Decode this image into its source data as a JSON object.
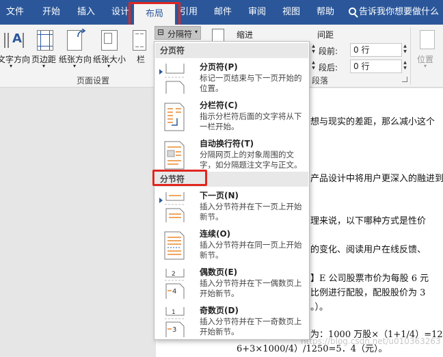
{
  "tabs": [
    "文件",
    "开始",
    "插入",
    "设计",
    "布局",
    "引用",
    "邮件",
    "审阅",
    "视图",
    "帮助"
  ],
  "active_tab": "布局",
  "tell_me": "告诉我你想要做什么",
  "ribbon": {
    "buttons": {
      "text_direction": "文字方向",
      "margins": "页边距",
      "orientation": "纸张方向",
      "size": "纸张大小",
      "columns": "栏"
    },
    "breaks_button": "分隔符",
    "group_page_setup": "页面设置",
    "indent_label": "缩进",
    "spacing_label": "间距",
    "spacing_before_label": "段前:",
    "spacing_before_value": "0 行",
    "spacing_after_label": "段后:",
    "spacing_after_value": "0 行",
    "group_paragraph_partial": "段落",
    "position_label": "位置"
  },
  "breaks_menu": {
    "page_breaks_header": "分页符",
    "page_items": [
      {
        "title": "分页符(P)",
        "desc": "标记一页结束与下一页开始的位置。"
      },
      {
        "title": "分栏符(C)",
        "desc": "指示分栏符后面的文字将从下一栏开始。"
      },
      {
        "title": "自动换行符(T)",
        "desc": "分隔网页上的对象周围的文字，如分隔题注文字与正文。"
      }
    ],
    "section_breaks_header": "分节符",
    "section_items": [
      {
        "title": "下一页(N)",
        "desc": "插入分节符并在下一页上开始新节。"
      },
      {
        "title": "连续(O)",
        "desc": "插入分节符并在同一页上开始新节。"
      },
      {
        "title": "偶数页(E)",
        "desc": "插入分节符并在下一偶数页上开始新节。"
      },
      {
        "title": "奇数页(D)",
        "desc": "插入分节符并在下一奇数页上开始新节。"
      }
    ]
  },
  "document_lines": [
    "想与现实的差距，那么减小这个",
    "产品设计中将用户更深入的融进到",
    "理来说，以下哪种方式是性价",
    "的变化、阅读用户在线反馈、",
    "】E 公司股票市价为每股 6 元",
    "比例进行配股，配股股价为 3",
    "。）。",
    "为：1000 万股×（1+1/4）=12",
    "6+3×1000/4）/1250=5．4（元）。"
  ],
  "watermark": "https://blog.csdn.net/u010363263",
  "colors": {
    "ribbon_blue": "#2b579a",
    "highlight_red": "#e0261f",
    "accent_orange": "#e8892c"
  }
}
